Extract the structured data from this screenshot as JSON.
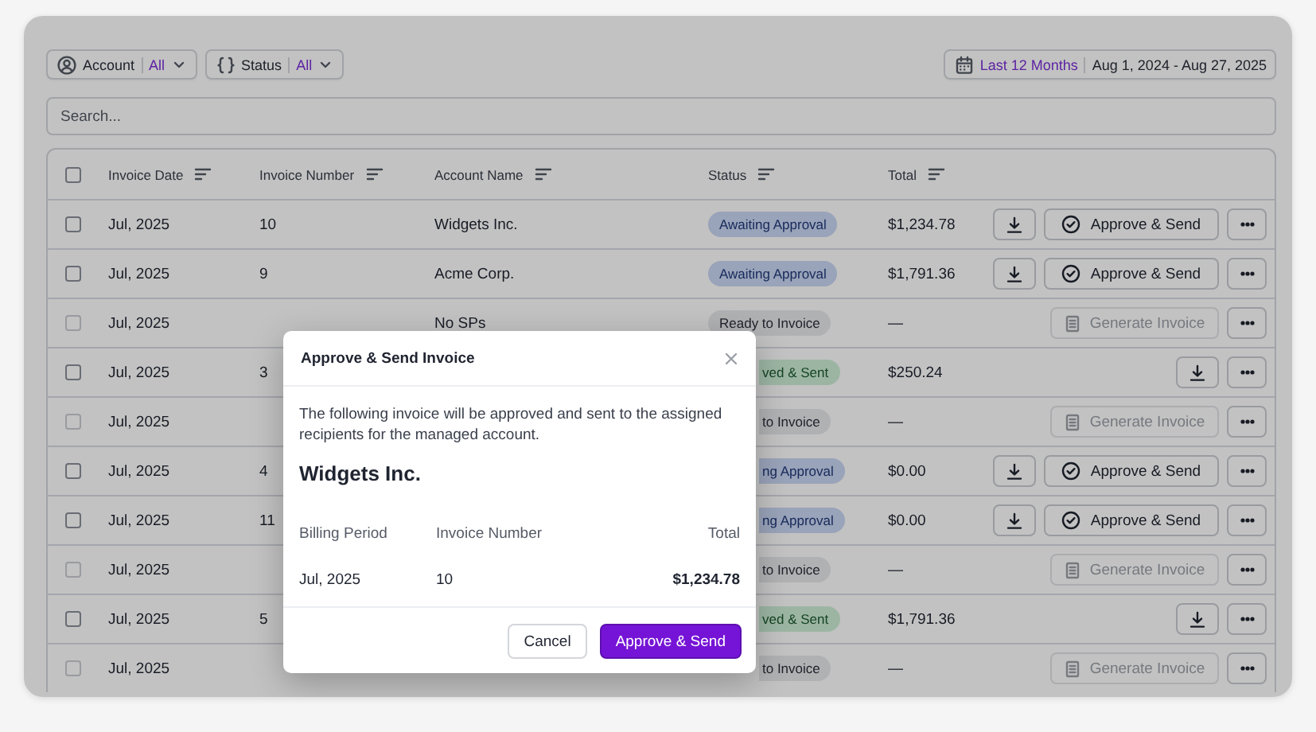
{
  "filters": [
    {
      "kind": "account",
      "label": "Account",
      "value": "All"
    },
    {
      "kind": "status",
      "label": "Status",
      "value": "All"
    }
  ],
  "date_range": {
    "preset": "Last 12 Months",
    "range": "Aug 1, 2024 - Aug 27, 2025"
  },
  "search": {
    "placeholder": "Search..."
  },
  "table": {
    "select_all": {
      "checked": false
    },
    "columns": [
      "Invoice Date",
      "Invoice Number",
      "Account Name",
      "Status",
      "Total"
    ],
    "rows": [
      {
        "checked": false,
        "disabled": false,
        "date": "Jul, 2025",
        "number": "10",
        "account": "Widgets Inc.",
        "status": {
          "text": "Awaiting Approval",
          "kind": "awaiting",
          "clipped": false
        },
        "total": "$1,234.78",
        "action": {
          "kind": "approve",
          "label": "Approve & Send"
        }
      },
      {
        "checked": false,
        "disabled": false,
        "date": "Jul, 2025",
        "number": "9",
        "account": "Acme Corp.",
        "status": {
          "text": "Awaiting Approval",
          "kind": "awaiting",
          "clipped": false
        },
        "total": "$1,791.36",
        "action": {
          "kind": "approve",
          "label": "Approve & Send"
        }
      },
      {
        "checked": false,
        "disabled": true,
        "date": "Jul, 2025",
        "account": "No SPs",
        "status": {
          "text": "Ready to Invoice",
          "kind": "ready",
          "clipped": false
        },
        "total": "—",
        "action": {
          "kind": "generate",
          "label": "Generate Invoice"
        }
      },
      {
        "checked": false,
        "disabled": false,
        "date": "Jul, 2025",
        "number": "3",
        "status": {
          "text": "ved & Sent",
          "kind": "sent",
          "clipped": true
        },
        "total": "$250.24",
        "action": {
          "kind": "download"
        }
      },
      {
        "checked": false,
        "disabled": true,
        "date": "Jul, 2025",
        "status": {
          "text": "to Invoice",
          "kind": "ready",
          "clipped": true
        },
        "total": "—",
        "action": {
          "kind": "generate",
          "label": "Generate Invoice"
        }
      },
      {
        "checked": false,
        "disabled": false,
        "date": "Jul, 2025",
        "number": "4",
        "status": {
          "text": "ng Approval",
          "kind": "awaiting",
          "clipped": true
        },
        "total": "$0.00",
        "action": {
          "kind": "approve",
          "label": "Approve & Send"
        }
      },
      {
        "checked": false,
        "disabled": false,
        "date": "Jul, 2025",
        "number": "11",
        "status": {
          "text": "ng Approval",
          "kind": "awaiting",
          "clipped": true
        },
        "total": "$0.00",
        "action": {
          "kind": "approve",
          "label": "Approve & Send"
        }
      },
      {
        "checked": false,
        "disabled": true,
        "date": "Jul, 2025",
        "status": {
          "text": "to Invoice",
          "kind": "ready",
          "clipped": true
        },
        "total": "—",
        "action": {
          "kind": "generate",
          "label": "Generate Invoice"
        }
      },
      {
        "checked": false,
        "disabled": false,
        "date": "Jul, 2025",
        "number": "5",
        "status": {
          "text": "ved & Sent",
          "kind": "sent",
          "clipped": true
        },
        "total": "$1,791.36",
        "action": {
          "kind": "download"
        }
      },
      {
        "checked": false,
        "disabled": true,
        "date": "Jul, 2025",
        "status": {
          "text": "to Invoice",
          "kind": "ready",
          "clipped": true
        },
        "total": "—",
        "action": {
          "kind": "generate",
          "label": "Generate Invoice"
        }
      }
    ]
  },
  "dialog": {
    "title": "Approve & Send Invoice",
    "message": "The following invoice will be approved and sent to the assigned recipients for the managed account.",
    "account": "Widgets Inc.",
    "columns": [
      "Billing Period",
      "Invoice Number",
      "Total"
    ],
    "row": [
      "Jul, 2025",
      "10",
      "$1,234.78"
    ],
    "buttons": [
      {
        "label": "Cancel",
        "kind": "secondary"
      },
      {
        "label": "Approve & Send",
        "kind": "primary"
      }
    ]
  }
}
